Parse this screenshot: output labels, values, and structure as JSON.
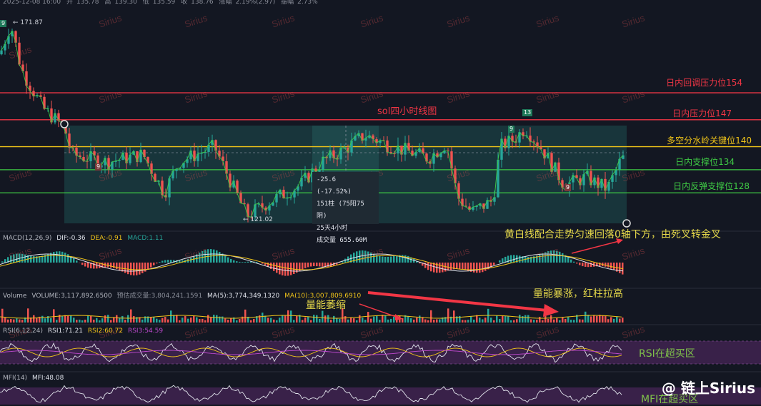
{
  "header": {
    "datetime": "2025-12-08 16:00",
    "open_label": "开",
    "open": "135.78",
    "high_label": "高",
    "high": "139.30",
    "low_label": "低",
    "low": "135.59",
    "close_label": "收",
    "close": "138.76",
    "change_label": "涨幅",
    "change": "2.19%(2.97)",
    "amp_label": "振幅",
    "amp": "2.73%"
  },
  "price": {
    "high_mark": "171.87",
    "low_mark": "121.02",
    "badges": [
      "9",
      "9",
      "13",
      "9",
      "9"
    ]
  },
  "levels": [
    {
      "label": "日内回调压力位154",
      "value": 154,
      "color": "#f23645"
    },
    {
      "label": "日内压力位147",
      "value": 147,
      "color": "#f23645"
    },
    {
      "label": "多空分水岭关键位140",
      "value": 140,
      "color": "#f0c419"
    },
    {
      "label": "日内支撑位134",
      "value": 134,
      "color": "#3fcc45"
    },
    {
      "label": "日内反弹支撑位128",
      "value": 128,
      "color": "#3fcc45"
    }
  ],
  "chart_title": "sol四小时线图",
  "infobox": {
    "line1": "-25.6 (-17.52%)",
    "line2": "151柱 (75阳75阴)",
    "line3": "25天4小时",
    "line4": "成交量 655.60M"
  },
  "macd": {
    "name": "MACD(12,26,9)",
    "dif": "DIF:-0.36",
    "dea": "DEA:-0.91",
    "macd": "MACD:1.11",
    "annotation": "黄白线配合走势匀速回落0轴下方，由死叉转金叉"
  },
  "volume": {
    "name": "Volume",
    "vol": "VOLUME:3,117,892.6500",
    "est": "预估成交量:3,804,241.1591",
    "ma5": "MA(5):3,774,349.1320",
    "ma10": "MA(10):3,007,809.6910",
    "annotation_left": "量能萎缩",
    "annotation_right": "量能暴涨，红柱拉高"
  },
  "rsi": {
    "name": "RSI(6,12,24)",
    "rsi1": "RSI1:71.21",
    "rsi2": "RSI2:60.72",
    "rsi3": "RSI3:54.59",
    "annotation": "RSI在超买区"
  },
  "mfi": {
    "name": "MFI(14)",
    "mfi": "MFI:48.08",
    "annotation": "MFI在超买区"
  },
  "watermark": "Sirius",
  "brand": "@ 链上Sirius"
}
